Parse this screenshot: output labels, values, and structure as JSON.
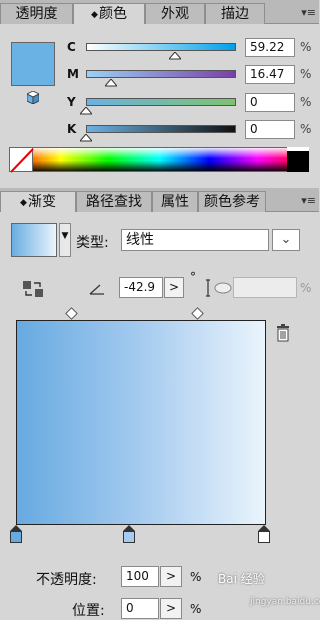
{
  "color_panel": {
    "tabs": [
      {
        "label": "透明度",
        "active": false
      },
      {
        "label": "颜色",
        "active": true
      },
      {
        "label": "外观",
        "active": false
      },
      {
        "label": "描边",
        "active": false
      }
    ],
    "menu_icon": "panel-menu-icon",
    "fill_color": "#6bb2e4",
    "channels": [
      {
        "label": "C",
        "value": "59.22",
        "unit": "%",
        "level": 59.22,
        "track": "linear-gradient(to right,#ffffff,#00a0e9)"
      },
      {
        "label": "M",
        "value": "16.47",
        "unit": "%",
        "level": 16.47,
        "track": "linear-gradient(to right,#9ad2f5,#7a3fa6)"
      },
      {
        "label": "Y",
        "value": "0",
        "unit": "%",
        "level": 0,
        "track": "linear-gradient(to right,#6bb2e4,#7cc36c)"
      },
      {
        "label": "K",
        "value": "0",
        "unit": "%",
        "level": 0,
        "track": "linear-gradient(to right,#6bb2e4,#111111)"
      }
    ]
  },
  "gradient_panel": {
    "tabs": [
      {
        "label": "渐变",
        "active": true
      },
      {
        "label": "路径查找",
        "active": false
      },
      {
        "label": "属性",
        "active": false
      },
      {
        "label": "颜色参考",
        "active": false
      }
    ],
    "type_label": "类型:",
    "type_value": "线性",
    "angle_value": "-42.9",
    "angle_unit": "°",
    "aspect_unit": "%",
    "opacity_label": "不透明度:",
    "opacity_value": "100",
    "opacity_unit": "%",
    "position_label": "位置:",
    "position_value": "0",
    "position_unit": "%",
    "start_color": "#67aae1",
    "end_color": "#eaf4fc"
  },
  "watermark": {
    "text": "Bai 经验",
    "sub": "jingyan.baidu.com"
  }
}
